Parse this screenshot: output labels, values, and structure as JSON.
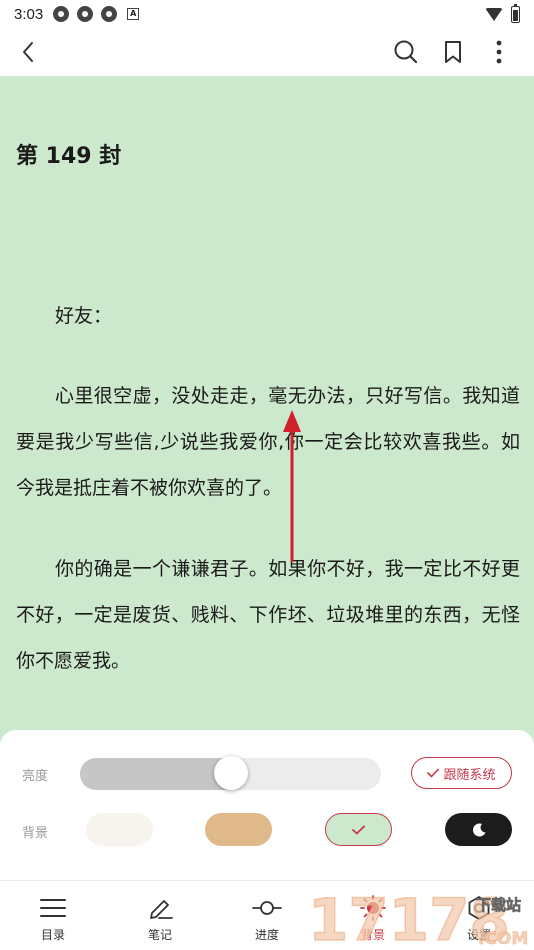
{
  "status_bar": {
    "time": "3:03"
  },
  "reader": {
    "chapter_title": "第 149 封",
    "paragraphs": [
      "好友：",
      "心里很空虚，没处走走，毫无办法，只好写信。我知道要是我少写些信,少说些我爱你,你一定会比较欢喜我些。如今我是抵庄着不被你欢喜的了。",
      "你的确是一个谦谦君子。如果你不好，我一定比不好更不好，一定是废货、贱料、下作坯、垃圾堆里的东西，无怪你不愿爱我。"
    ]
  },
  "settings_panel": {
    "brightness_label": "亮度",
    "brightness_level": 0.5,
    "follow_system_label": "跟随系统",
    "background_label": "背景",
    "backgrounds": [
      {
        "name": "white",
        "color": "#f7f4ef",
        "selected": false
      },
      {
        "name": "tan",
        "color": "#e0b98b",
        "selected": false
      },
      {
        "name": "green",
        "color": "#cde9cd",
        "selected": true
      },
      {
        "name": "night",
        "color": "#1c1c1c",
        "selected": false
      }
    ]
  },
  "bottom_nav": [
    {
      "label": "目录",
      "icon": "list-icon"
    },
    {
      "label": "笔记",
      "icon": "pencil-icon"
    },
    {
      "label": "进度",
      "icon": "progress-icon"
    },
    {
      "label": "背景",
      "icon": "sun-icon",
      "active": true
    },
    {
      "label": "设置",
      "icon": "gear-icon"
    }
  ],
  "watermark": {
    "text": "17178",
    "sub": "下载站",
    "domain": ".COM"
  },
  "colors": {
    "accent": "#c8394a",
    "reading_background": "#cde9cd",
    "annotation_arrow": "#d0202a"
  }
}
